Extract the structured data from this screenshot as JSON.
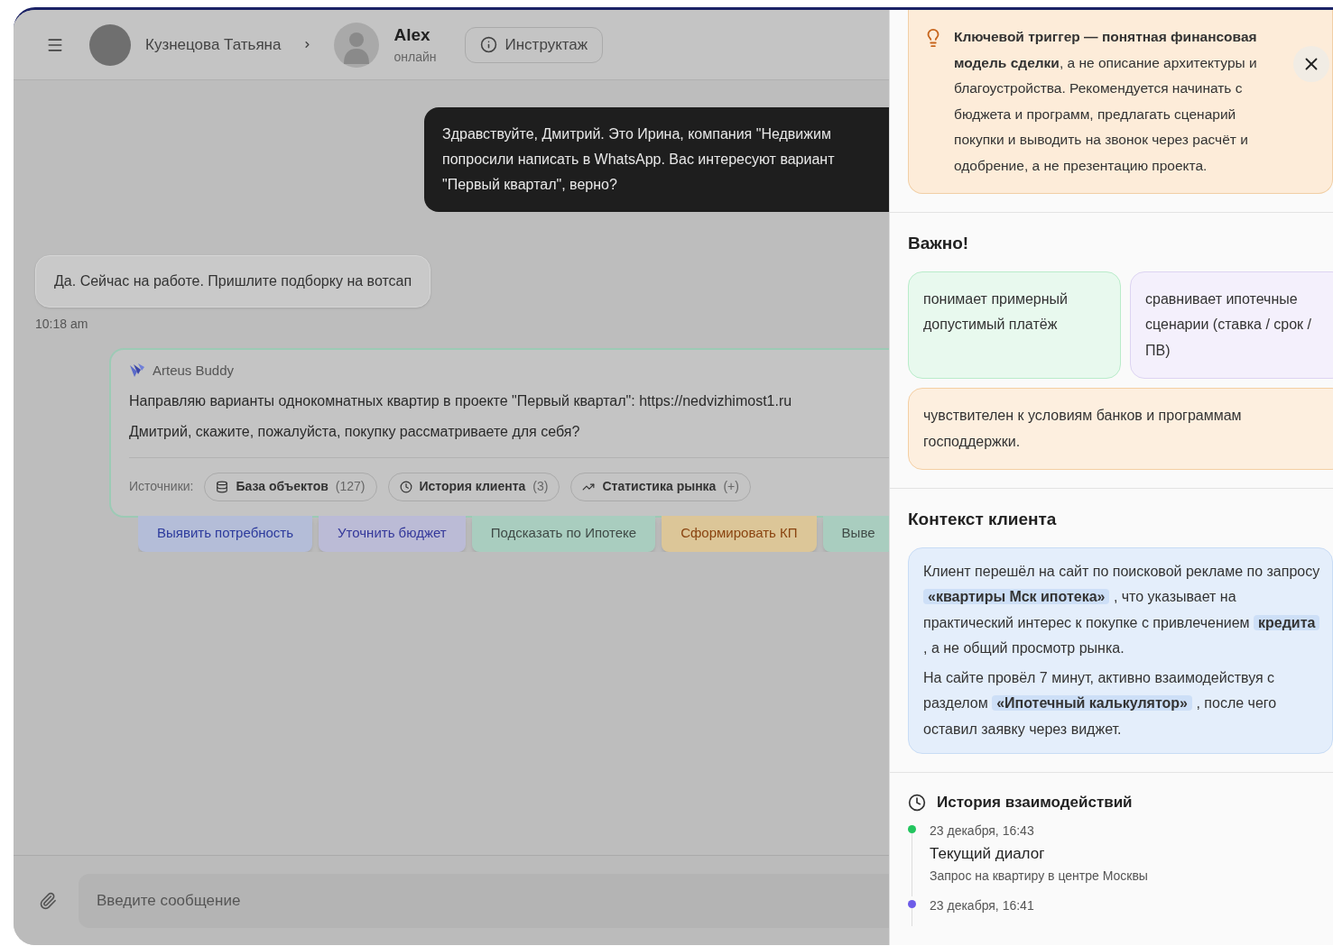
{
  "header": {
    "user_name": "Кузнецова Татьяна",
    "contact_name": "Alex",
    "contact_status": "онлайн",
    "instruction_button": "Инструктаж"
  },
  "messages": [
    {
      "kind": "outgoing",
      "lines": [
        "Здравствуйте, Дмитрий. Это Ирина, компания \"Недвижим",
        "попросили написать в WhatsApp. Вас интересуют вариант",
        "\"Первый квартал\", верно?"
      ]
    },
    {
      "kind": "incoming",
      "text": "Да. Сейчас на работе. Пришлите подборку на вотсап",
      "time": "10:18 am"
    },
    {
      "kind": "bot",
      "author": "Arteus Buddy",
      "lines": [
        "Направляю варианты однокомнатных квартир в проекте \"Первый квартал\": https://nedvizhimost1.ru",
        "Дмитрий, скажите, пожалуйста, покупку рассматриваете для себя?"
      ],
      "sources_label": "Источники:",
      "sources": [
        {
          "kind": "database",
          "label": "База объектов",
          "count": "(127)"
        },
        {
          "kind": "history",
          "label": "История клиента",
          "count": "(3)"
        },
        {
          "kind": "trend",
          "label": "Статистика рынка",
          "count": "(+)"
        }
      ]
    }
  ],
  "quick_actions": [
    {
      "kind": "blue",
      "label": "Выявить потребность"
    },
    {
      "kind": "violet",
      "label": "Уточнить бюджет"
    },
    {
      "kind": "green",
      "label": "Подсказать по Ипотеке"
    },
    {
      "kind": "amber",
      "label": "Сформировать КП"
    },
    {
      "kind": "green",
      "label": "Выве"
    }
  ],
  "composer": {
    "placeholder": "Введите сообщение"
  },
  "panel": {
    "trigger": {
      "text": "**Ключевой триггер — понятная финансовая модель сделки**, а не описание архитектуры и благоустройства. Рекомендуется начинать с бюджета и программ, предлагать сценарий покупки и выводить на звонок через расчёт и одобрение, а не презентацию проекта."
    },
    "important": {
      "title": "Важно!",
      "cards": [
        {
          "kind": "green",
          "text": "понимает примерный допустимый платёж"
        },
        {
          "kind": "violet",
          "text": "сравнивает ипотечные сценарии (ставка / срок / ПВ)"
        },
        {
          "kind": "amber",
          "text": "чувствителен к условиям банков и программам господдержки."
        }
      ]
    },
    "context": {
      "title": "Контекст клиента",
      "paragraphs": [
        "Клиент перешёл на сайт по поисковой рекламе по запросу **«квартиры Мск ипотека»** , что указывает на практический интерес к покупке с привлечением **кредита** , а не общий просмотр рынка.",
        "На сайте провёл 7 минут, активно взаимодействуя с разделом **«Ипотечный калькулятор»** , после чего оставил заявку через виджет."
      ]
    },
    "history": {
      "title": "История взаимодействий",
      "items": [
        {
          "color": "#22c55e",
          "date": "23 декабря, 16:43",
          "title": "Текущий диалог",
          "subtitle": "Запрос на квартиру в центре Москвы"
        },
        {
          "color": "#6d5ce8",
          "date": "23 декабря, 16:41"
        }
      ]
    }
  }
}
